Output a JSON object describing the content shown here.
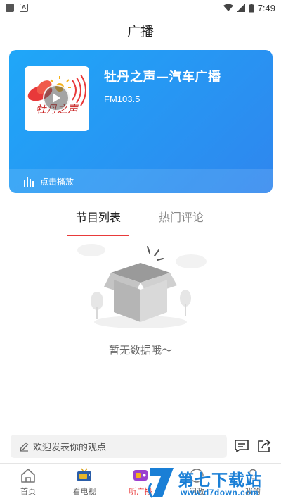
{
  "status_bar": {
    "time": "7:49"
  },
  "header": {
    "title": "广播"
  },
  "station": {
    "name": "牡丹之声—汽车广播",
    "frequency": "FM103.5",
    "logo_text": "牡丹之声",
    "play_label": "点击播放"
  },
  "tabs": [
    {
      "label": "节目列表",
      "active": true
    },
    {
      "label": "热门评论",
      "active": false
    }
  ],
  "empty_state": {
    "message": "暂无数据哦～"
  },
  "comment_bar": {
    "placeholder": "欢迎发表你的观点"
  },
  "bottom_nav": [
    {
      "label": "首页",
      "icon": "home-icon"
    },
    {
      "label": "看电视",
      "icon": "tv-icon"
    },
    {
      "label": "听广播",
      "icon": "radio-icon",
      "active": true
    },
    {
      "label": "问政",
      "icon": "question-icon"
    },
    {
      "label": "我的",
      "icon": "user-icon"
    }
  ],
  "watermark": {
    "main": "第七下载站",
    "sub": "www.d7down.com"
  },
  "colors": {
    "accent": "#e83a3a",
    "card_start": "#1fa7f8",
    "card_end": "#2f86ee"
  }
}
